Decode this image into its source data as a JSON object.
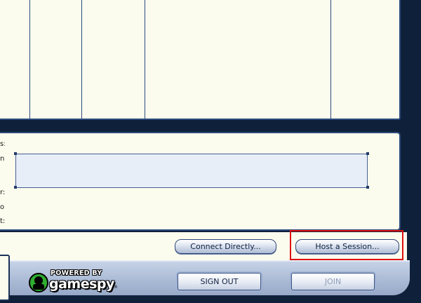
{
  "details": {
    "field_labels": [
      "s:",
      "n:",
      "r:",
      "o:",
      "t:"
    ]
  },
  "buttons": {
    "connect_directly": "Connect Directly...",
    "host_session": "Host a Session...",
    "sign_out": "SIGN OUT",
    "join": "JOIN"
  },
  "logo": {
    "powered_by": "POWERED BY",
    "brand": "gamespy"
  },
  "colors": {
    "panel_bg": "#fcfcee",
    "border": "#2b4a7c",
    "app_bg": "#0f213a",
    "highlight": "#e01010",
    "logo_green": "#2fae2f"
  }
}
